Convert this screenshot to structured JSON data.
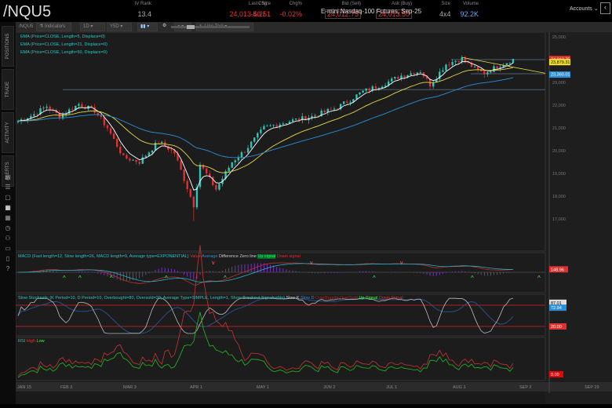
{
  "header": {
    "symbol": "/NQU5",
    "quotes": [
      {
        "label": "IV Rank",
        "value": "13.4",
        "style": ""
      },
      {
        "label": "Last / Size",
        "value": "24,013.50 / 1",
        "style": "red"
      },
      {
        "label": "Chg",
        "value": "-4.25",
        "style": "red"
      },
      {
        "label": "Chg%",
        "value": "-0.02%",
        "style": "red"
      },
      {
        "label": "Bid (Sell)",
        "value": "24,012.75",
        "style": "box"
      },
      {
        "label": "Ask (Buy)",
        "value": "24,013.50",
        "style": "box"
      },
      {
        "label": "Size",
        "value": "4x4",
        "style": ""
      },
      {
        "label": "Volume",
        "value": "92.2K",
        "style": ""
      }
    ],
    "description": "E-mini Nasdaq-100 Futures, Sep-25",
    "accounts": "Accounts"
  },
  "sidebar": {
    "tabs": [
      "POSITIONS",
      "TRADE",
      "ACTIVITY",
      "ALERTS"
    ]
  },
  "toolbar": {
    "symbol": "/NQU5",
    "studies": "Indicators",
    "period": "1D",
    "interval": "Y5D",
    "style": "",
    "drawing": "Line Tool"
  },
  "studies": {
    "ema": [
      "EMA (Price=CLOSE, Length=5, Displace=0)",
      "EMA (Price=CLOSE, Length=21, Displace=0)",
      "EMA (Price=CLOSE, Length=50, Displace=0)"
    ],
    "macd": {
      "title": "MACD (Fast length=12, Slow length=26, MACD length=9, Average type=EXPONENTIAL)",
      "items": [
        "Value",
        "Average",
        "Difference",
        "Zero line",
        "Up signal",
        "Down signal"
      ],
      "value": "148.96"
    },
    "stoch": {
      "title": "Slow Stochastic (K Period=10, D Period=10, Overbought=80, Oversold=20, Average Type=SIMPLE, Length=1, Show Breakout Signals=No)",
      "items": [
        "Slow K",
        "Slow D",
        "OverBought",
        "OverSold",
        "Up Signal",
        "Down Signal"
      ],
      "k": "87.01",
      "d": "72.94",
      "os": "20.00"
    },
    "rsi": {
      "title": "RSI",
      "items": [
        "High",
        "Low"
      ],
      "value": "0.00"
    }
  },
  "price_axis": {
    "labels": [
      "25,000",
      "23,000",
      "22,000",
      "21,000",
      "20,000",
      "19,000",
      "18,000",
      "17,000"
    ],
    "last": "24,013.75",
    "ema_a": "23,879.31",
    "ema_b": "23,360.01"
  },
  "date_axis": [
    "JAN 15",
    "FEB 3",
    "MAR 3",
    "APR 1",
    "MAY 1",
    "JUN 2",
    "JUL 1",
    "AUG 1",
    "SEP 2",
    "SEP 29"
  ],
  "chart_data": {
    "type": "candlestick",
    "title": "/NQU5 daily",
    "ylim": [
      16800,
      25200
    ],
    "keyframes": [
      [
        0,
        21300
      ],
      [
        5,
        21600
      ],
      [
        9,
        21950
      ],
      [
        13,
        21500
      ],
      [
        19,
        22050
      ],
      [
        24,
        21750
      ],
      [
        28,
        21000
      ],
      [
        33,
        19700
      ],
      [
        38,
        19500
      ],
      [
        44,
        20400
      ],
      [
        49,
        19900
      ],
      [
        55,
        17600
      ],
      [
        57,
        19400
      ],
      [
        62,
        18300
      ],
      [
        67,
        19500
      ],
      [
        71,
        20000
      ],
      [
        77,
        21000
      ],
      [
        85,
        21300
      ],
      [
        92,
        21500
      ],
      [
        100,
        21900
      ],
      [
        108,
        22600
      ],
      [
        114,
        22900
      ],
      [
        120,
        23300
      ],
      [
        126,
        23500
      ],
      [
        129,
        22900
      ],
      [
        134,
        23800
      ],
      [
        139,
        24050
      ],
      [
        143,
        23600
      ],
      [
        146,
        23400
      ],
      [
        150,
        23700
      ],
      [
        155,
        24013
      ]
    ],
    "colors": {
      "up": "#2ec4b6",
      "down": "#e03030",
      "ema5": "#ffffff",
      "ema21": "#e8d84a",
      "ema50": "#2a8fd8"
    }
  }
}
